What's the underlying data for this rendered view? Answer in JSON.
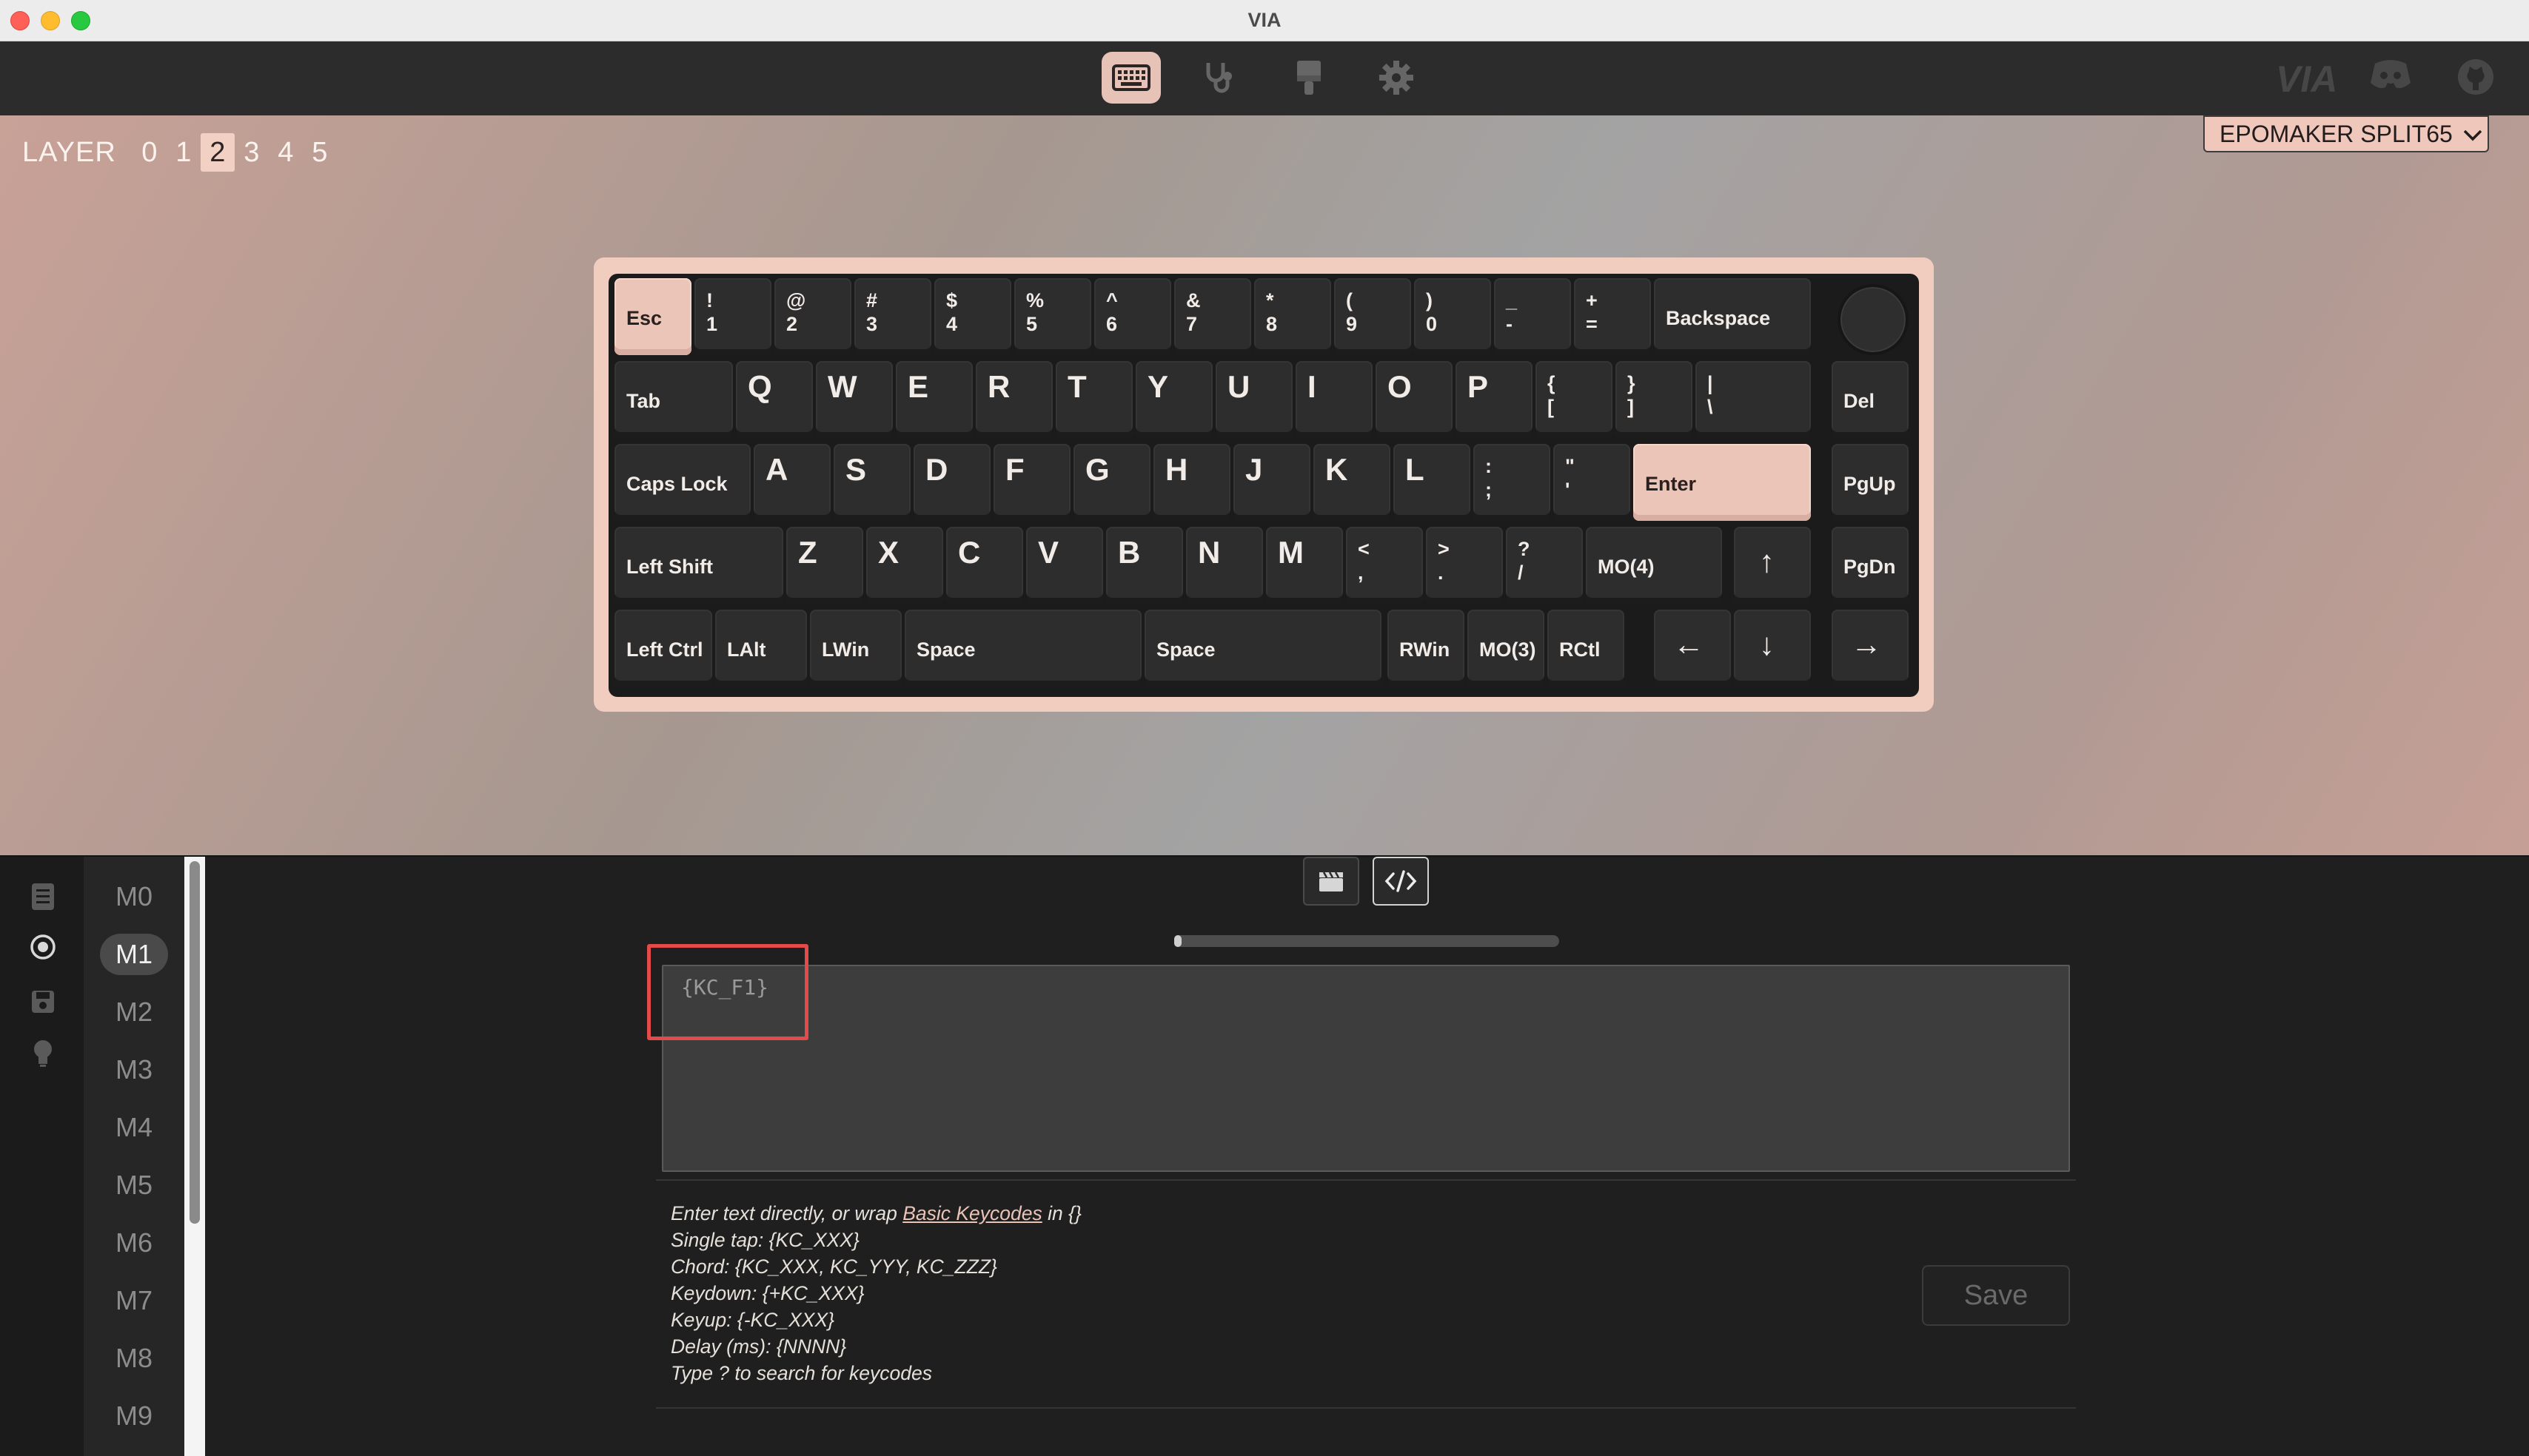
{
  "window": {
    "title": "VIA"
  },
  "nav": {
    "tabs": [
      {
        "icon": "keyboard-icon",
        "active": true
      },
      {
        "icon": "stethoscope-icon",
        "active": false
      },
      {
        "icon": "paint-brush-icon",
        "active": false
      },
      {
        "icon": "gear-icon",
        "active": false
      }
    ],
    "brand_text": "VIA",
    "links": [
      "discord-icon",
      "github-icon"
    ]
  },
  "layers": {
    "label": "LAYER",
    "items": [
      "0",
      "1",
      "2",
      "3",
      "4",
      "5"
    ],
    "active": "2"
  },
  "keyboard_selector": {
    "value": "EPOMAKER SPLIT65"
  },
  "keys": {
    "esc": "Esc",
    "k1": "!\n1",
    "k2": "@\n2",
    "k3": "#\n3",
    "k4": "$\n4",
    "k5": "%\n5",
    "k6": "^\n6",
    "k7": "&\n7",
    "k8": "*\n8",
    "k9": "(\n9",
    "k0": ")\n0",
    "minus": "_\n-",
    "equal": "+\n=",
    "backspace": "Backspace",
    "tab": "Tab",
    "q": "Q",
    "w": "W",
    "e": "E",
    "r": "R",
    "t": "T",
    "y": "Y",
    "u": "U",
    "i": "I",
    "o": "O",
    "p": "P",
    "lbracket": "{\n[",
    "rbracket": "}\n]",
    "backslash": "|\n\\",
    "del": "Del",
    "caps": "Caps Lock",
    "a": "A",
    "s": "S",
    "d": "D",
    "f": "F",
    "g": "G",
    "h": "H",
    "j": "J",
    "k": "K",
    "l": "L",
    "semicolon": ":\n;",
    "quote": "\"\n'",
    "enter": "Enter",
    "pgup": "PgUp",
    "lshift": "Left Shift",
    "z": "Z",
    "x": "X",
    "c": "C",
    "v": "V",
    "b": "B",
    "n": "N",
    "m": "M",
    "comma": "<\n,",
    "period": ">\n.",
    "slash": "?\n/",
    "mo4": "MO(4)",
    "up": "↑",
    "pgdn": "PgDn",
    "lctrl": "Left Ctrl",
    "lalt": "LAlt",
    "lwin": "LWin",
    "space1": "Space",
    "space2": "Space",
    "rwin": "RWin",
    "mo3": "MO(3)",
    "rctl": "RCtl",
    "left": "←",
    "down": "↓",
    "right": "→"
  },
  "sidebar": {
    "icons": [
      "document-icon",
      "record-icon",
      "save-icon",
      "lightbulb-icon"
    ],
    "macros": [
      "M0",
      "M1",
      "M2",
      "M3",
      "M4",
      "M5",
      "M6",
      "M7",
      "M8",
      "M9"
    ],
    "active_macro": "M1"
  },
  "macro_editor": {
    "toolbar": [
      "clapperboard-icon",
      "code-icon"
    ],
    "progress": 0.02,
    "text": "{KC_F1}",
    "help": {
      "line1_a": "Enter text directly, or wrap ",
      "line1_link": "Basic Keycodes",
      "line1_b": " in {}",
      "line2": "Single tap: {KC_XXX}",
      "line3": "Chord: {KC_XXX, KC_YYY, KC_ZZZ}",
      "line4": "Keydown: {+KC_XXX}",
      "line5": "Keyup: {-KC_XXX}",
      "line6": "Delay (ms): {NNNN}",
      "line7": "Type ? to search for keycodes"
    },
    "save_label": "Save"
  },
  "colors": {
    "accent": "#ecc5b9",
    "highlight": "#e34b4b"
  }
}
